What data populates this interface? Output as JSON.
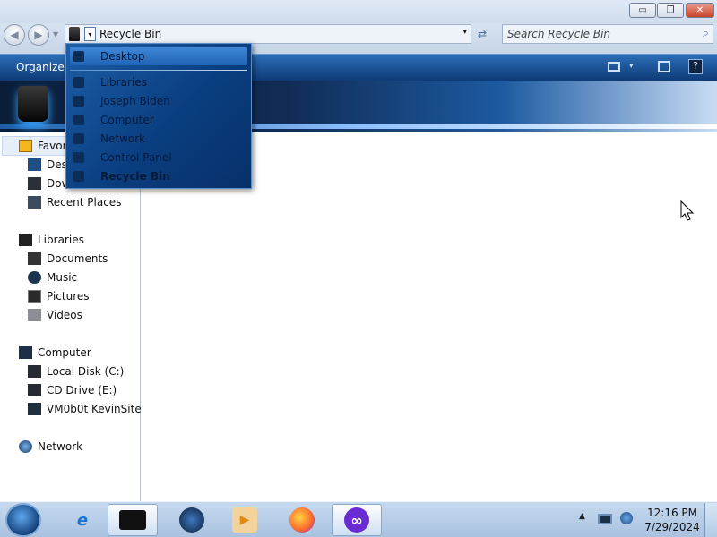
{
  "window": {
    "minimize": "▭",
    "maximize": "❐",
    "close": "✕"
  },
  "navigation": {
    "back": "◀",
    "forward": "▶",
    "history": "▼"
  },
  "address": {
    "location": "Recycle Bin",
    "dropdown_arrow": "▾"
  },
  "refresh": "⇄",
  "search": {
    "placeholder": "Search Recycle Bin",
    "icon": "search-icon"
  },
  "toolbar": {
    "organize": "Organize",
    "organize_arrow": "▾",
    "view_arrow": "▾",
    "help": "?"
  },
  "nav_pane": {
    "items": [
      {
        "label": "Favorites",
        "icon": "star-icon"
      },
      {
        "label": "Desktop",
        "icon": "desktop-icon"
      },
      {
        "label": "Downloads",
        "icon": "downloads-icon"
      },
      {
        "label": "Recent Places",
        "icon": "recent-places-icon"
      },
      {
        "label": "Libraries",
        "icon": "libraries-icon"
      },
      {
        "label": "Documents",
        "icon": "documents-icon"
      },
      {
        "label": "Music",
        "icon": "music-icon"
      },
      {
        "label": "Pictures",
        "icon": "pictures-icon"
      },
      {
        "label": "Videos",
        "icon": "videos-icon"
      },
      {
        "label": "Computer",
        "icon": "computer-icon"
      },
      {
        "label": "Local Disk (C:)",
        "icon": "disk-icon"
      },
      {
        "label": "CD Drive (E:)",
        "icon": "cd-drive-icon"
      },
      {
        "label": "VM0b0t KevinSite",
        "icon": "network-drive-icon"
      },
      {
        "label": "Network",
        "icon": "network-icon"
      }
    ]
  },
  "dropdown": {
    "items": [
      {
        "label": "Desktop"
      },
      {
        "label": "Libraries"
      },
      {
        "label": "Joseph Biden"
      },
      {
        "label": "Computer"
      },
      {
        "label": "Network"
      },
      {
        "label": "Control Panel"
      },
      {
        "label": "Recycle Bin"
      }
    ]
  },
  "taskbar": {
    "apps": [
      {
        "name": "internet-explorer",
        "glyph": "e",
        "color": "#1b75d0"
      },
      {
        "name": "windows-explorer",
        "glyph": "",
        "color": "#111111"
      },
      {
        "name": "media-center",
        "glyph": "",
        "color": "#18426f"
      },
      {
        "name": "media-player",
        "glyph": "▶",
        "color": "#e08a14"
      },
      {
        "name": "firefox",
        "glyph": "",
        "color": "#ff7130"
      },
      {
        "name": "browser-app",
        "glyph": "∞",
        "color": "#6a2bd2"
      }
    ],
    "tray": {
      "arrow": "▲",
      "time": "12:16 PM",
      "date": "7/29/2024"
    }
  },
  "colors": {
    "command_bar": "#1c4f8f",
    "dropdown_bg": "#0a3e80",
    "taskbar": "#b8cde6"
  }
}
